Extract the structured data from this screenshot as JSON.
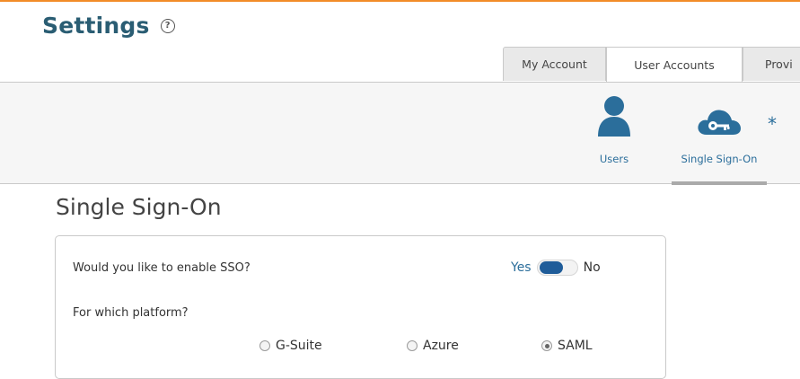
{
  "page": {
    "title": "Settings",
    "help_icon": "question-circle-icon"
  },
  "tabs": [
    {
      "label": "My Account",
      "active": false
    },
    {
      "label": "User Accounts",
      "active": true
    },
    {
      "label": "Provi",
      "active": false
    }
  ],
  "subnav": {
    "items": [
      {
        "label": "Users",
        "icon": "user-icon"
      },
      {
        "label": "Single Sign-On",
        "icon": "cloud-key-icon",
        "marker": "*",
        "active": true
      }
    ]
  },
  "section": {
    "title": "Single Sign-On",
    "q_enable": "Would you like to enable SSO?",
    "toggle": {
      "yes": "Yes",
      "no": "No",
      "value": "Yes"
    },
    "q_platform": "For which platform?",
    "platforms": [
      {
        "label": "G-Suite",
        "checked": false
      },
      {
        "label": "Azure",
        "checked": false
      },
      {
        "label": "SAML",
        "checked": true
      }
    ]
  },
  "colors": {
    "accent": "#2b6e9b",
    "title": "#2a5d73",
    "top_border": "#f28c28",
    "toggle_knob": "#1f5c99"
  }
}
